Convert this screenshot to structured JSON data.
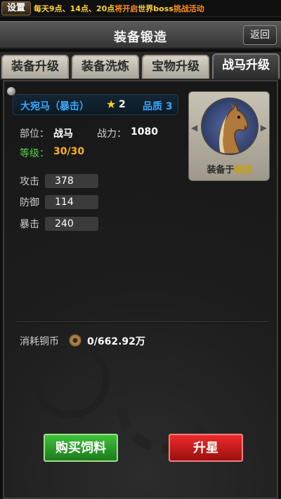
{
  "banner": {
    "settings_label": "设置",
    "notice_part1": "每天9点、14点、20点",
    "notice_part2": "将开启",
    "notice_part3": "世界boss",
    "notice_part4": "挑战活动"
  },
  "header": {
    "title": "装备锻造",
    "back_label": "返回"
  },
  "tabs": [
    {
      "label": "装备升级"
    },
    {
      "label": "装备洗炼"
    },
    {
      "label": "宝物升级"
    },
    {
      "label": "战马升级"
    }
  ],
  "active_tab": "战马升级",
  "horse": {
    "name": "大宛马（暴击）",
    "stars": "2",
    "quality": "品质 3",
    "part_label": "部位：",
    "part_value": "战马",
    "power_label": "战力：",
    "power_value": "1080",
    "level_label": "等级：",
    "level_value": "30/30",
    "equipped_prefix": "装备于",
    "equipped_to": "甄姬"
  },
  "stats": [
    {
      "label": "攻击",
      "value": "378"
    },
    {
      "label": "防御",
      "value": "114"
    },
    {
      "label": "暴击",
      "value": "240"
    }
  ],
  "cost": {
    "label": "消耗铜币",
    "value": "0/662.92万"
  },
  "buttons": {
    "buy_feed": "购买饲料",
    "star_up": "升星"
  },
  "colors": {
    "name_blue": "#38a8ff",
    "level_green": "#55d14a",
    "level_orange": "#ffb21a",
    "buy_green": "#2ea42a",
    "star_red": "#d01f1f"
  },
  "icons": [
    "star-icon",
    "coin-icon",
    "horse-portrait",
    "pin-icon",
    "arrow-left-icon",
    "arrow-right-icon"
  ]
}
